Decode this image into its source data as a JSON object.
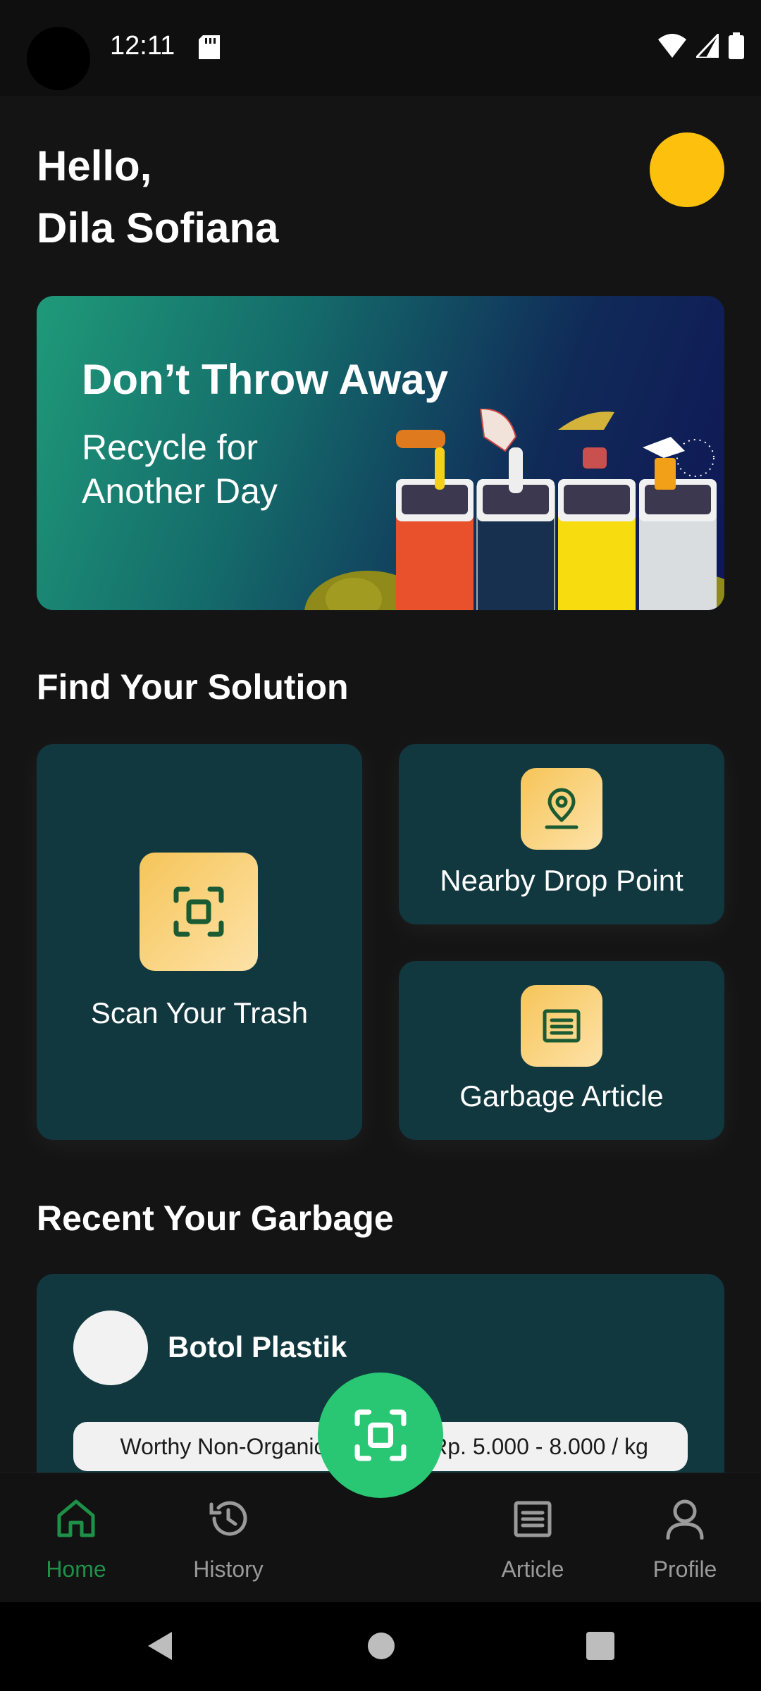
{
  "status_bar": {
    "time": "12:11"
  },
  "greeting": {
    "line1": "Hello,",
    "line2": "Dila Sofiana"
  },
  "banner": {
    "title": "Don’t Throw Away",
    "subtitle": "Recycle for Another Day"
  },
  "solution_section": {
    "title": "Find Your Solution",
    "scan_label": "Scan Your Trash",
    "drop_label": "Nearby Drop Point",
    "article_label": "Garbage Article"
  },
  "recent_section": {
    "title": "Recent Your Garbage",
    "item": {
      "name": "Botol Plastik",
      "category": "Worthy Non-Organic",
      "price": "Rp. 5.000 - 8.000 / kg"
    }
  },
  "bottom_nav": {
    "items": [
      {
        "label": "Home",
        "icon": "home-icon",
        "active": true
      },
      {
        "label": "History",
        "icon": "history-icon",
        "active": false
      },
      {
        "label": "Article",
        "icon": "article-icon",
        "active": false
      },
      {
        "label": "Profile",
        "icon": "profile-icon",
        "active": false
      }
    ],
    "fab_icon": "scan-icon"
  },
  "colors": {
    "accent": "#29c773",
    "card": "#11383f",
    "avatar": "#fcc00d",
    "active_nav": "#1e9149"
  }
}
